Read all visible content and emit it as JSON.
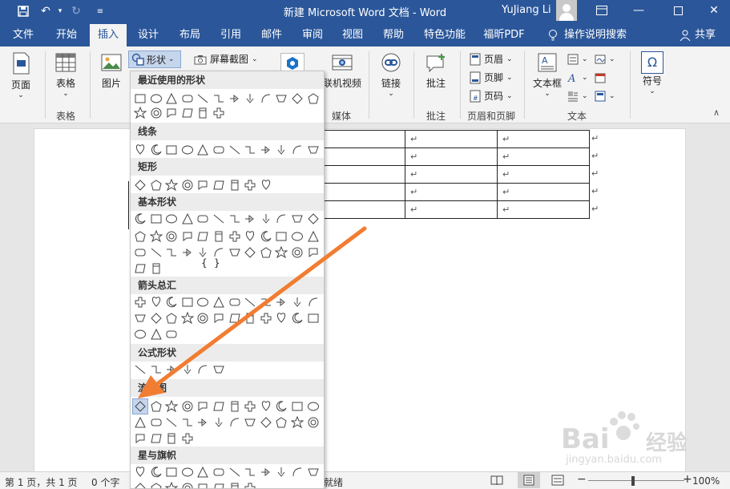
{
  "window": {
    "title": "新建 Microsoft Word 文档  -  Word",
    "user": "YuJiang Li"
  },
  "tabs": [
    "文件",
    "开始",
    "插入",
    "设计",
    "布局",
    "引用",
    "邮件",
    "审阅",
    "视图",
    "帮助",
    "特色功能",
    "福昕PDF",
    "操作说明搜索",
    "共享"
  ],
  "ribbon": {
    "page": "页面",
    "table": "表格",
    "table_group": "表格",
    "picture": "图片",
    "shapes": "形状",
    "screenshot": "屏幕截图",
    "online_video": "联机视频",
    "media_group": "媒体",
    "link": "链接",
    "comment": "批注",
    "comment_group": "批注",
    "header": "页眉",
    "footer": "页脚",
    "page_number": "页码",
    "hf_group": "页眉和页脚",
    "textbox": "文本框",
    "text_group": "文本",
    "symbol": "符号"
  },
  "shapes_menu": {
    "categories": [
      "最近使用的形状",
      "线条",
      "矩形",
      "基本形状",
      "箭头总汇",
      "公式形状",
      "流程图",
      "星与旗帜"
    ],
    "basic_glyphs": [
      "{",
      "}",
      "{",
      "}"
    ]
  },
  "document": {
    "cell_mark": "↵"
  },
  "status": {
    "page_info": "第 1 页，共 1 页",
    "words": "0 个字",
    "ready": "就绪",
    "zoom": "100%",
    "minus": "−",
    "plus": "+"
  },
  "watermark": {
    "brand": "Bai",
    "brand2": "经验",
    "url": "jingyan.baidu.com"
  },
  "colors": {
    "accent": "#2b579a",
    "arrow": "#f07d32"
  }
}
